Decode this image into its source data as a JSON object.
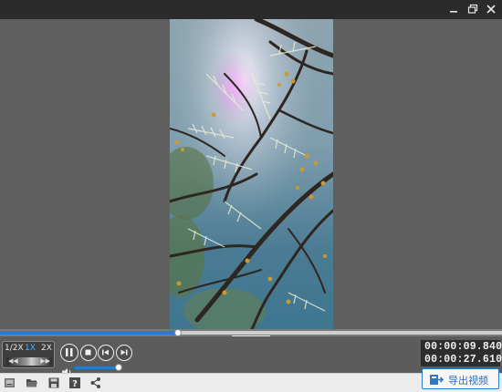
{
  "window": {
    "minimize_icon": "minimize-icon",
    "restore_icon": "restore-icon",
    "close_icon": "close-icon"
  },
  "video": {
    "content": "sunlit acacia branches against blue sky"
  },
  "playback": {
    "progress": 0.355,
    "speed_options": [
      "1/2X",
      "1X",
      "2X"
    ],
    "selected_speed": "1X",
    "volume_level": 0.95,
    "current_time": "00:00:09.840",
    "total_time": "00:00:27.610"
  },
  "toolbar": {
    "export_label": "导出视频"
  },
  "colors": {
    "accent": "#2f79c8",
    "titlebar": "#2b2b2b",
    "background": "#5f5f5f"
  }
}
